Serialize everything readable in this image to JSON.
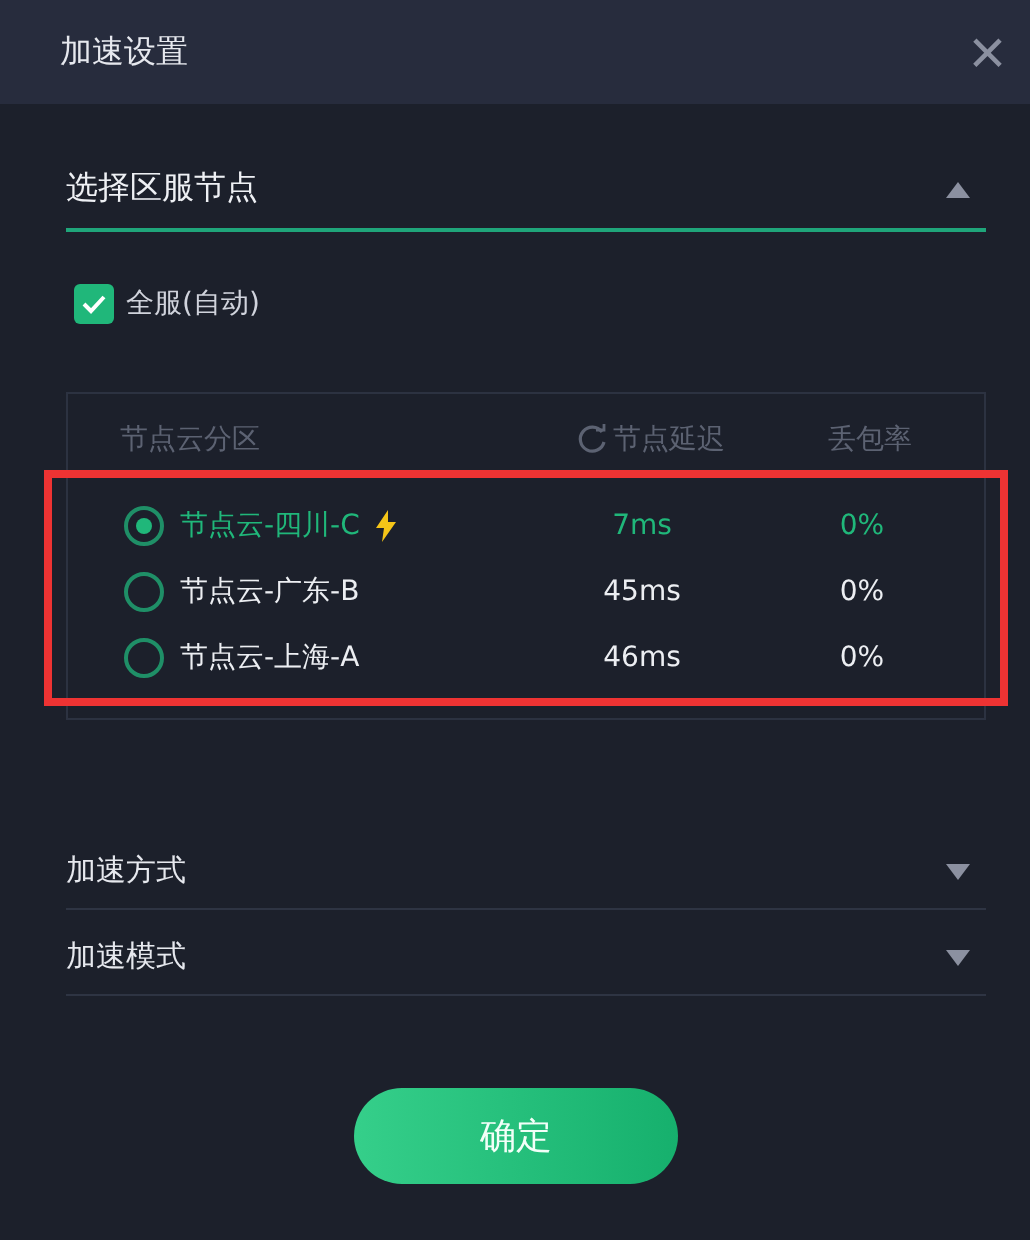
{
  "window": {
    "title": "加速设置",
    "close": "×"
  },
  "section": {
    "title": "选择区服节点",
    "expanded": true
  },
  "auto": {
    "label": "全服(自动)",
    "checked": true
  },
  "table": {
    "columns": [
      "节点云分区",
      "节点延迟",
      "丢包率"
    ],
    "rows": [
      {
        "name": "节点云-四川-C",
        "latency": "7ms",
        "loss": "0%",
        "selected": true,
        "fast": true
      },
      {
        "name": "节点云-广东-B",
        "latency": "45ms",
        "loss": "0%",
        "selected": false,
        "fast": false
      },
      {
        "name": "节点云-上海-A",
        "latency": "46ms",
        "loss": "0%",
        "selected": false,
        "fast": false
      }
    ]
  },
  "dropdowns": [
    {
      "label": "加速方式",
      "expanded": false
    },
    {
      "label": "加速模式",
      "expanded": false
    }
  ],
  "button": "确定"
}
